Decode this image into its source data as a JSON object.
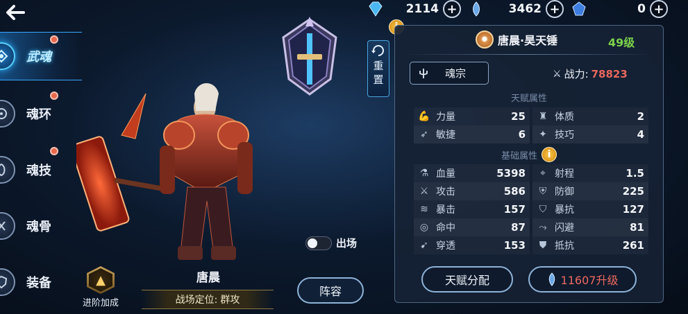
{
  "currencies": [
    {
      "name": "diamond",
      "value": "2114"
    },
    {
      "name": "soul-crystal",
      "value": "3462"
    },
    {
      "name": "blue-gem",
      "value": "0"
    }
  ],
  "nav": {
    "items": [
      {
        "label": "武魂",
        "active": true
      },
      {
        "label": "魂环"
      },
      {
        "label": "魂技"
      },
      {
        "label": "魂骨"
      },
      {
        "label": "装备"
      }
    ]
  },
  "hero": {
    "name": "唐晨",
    "role_label": "战场定位:",
    "role_value": "群攻",
    "advance_label": "进阶加成",
    "toggle_label": "出场",
    "formation_label": "阵容"
  },
  "reset_label": "重置",
  "panel": {
    "weapon_name": "唐晨·昊天锤",
    "level": "49级",
    "sect_label": "魂宗",
    "power_label": "战力:",
    "power_value": "78823",
    "talent_title": "天赋属性",
    "talent_stats": [
      {
        "icon": "arm-icon",
        "name": "力量",
        "value": "25"
      },
      {
        "icon": "body-icon",
        "name": "体质",
        "value": "2"
      },
      {
        "icon": "feather-icon",
        "name": "敏捷",
        "value": "6"
      },
      {
        "icon": "skill-icon",
        "name": "技巧",
        "value": "4"
      }
    ],
    "base_title": "基础属性",
    "base_stats": [
      {
        "icon": "potion-icon",
        "name": "血量",
        "value": "5398"
      },
      {
        "icon": "crosshair-icon",
        "name": "射程",
        "value": "1.5"
      },
      {
        "icon": "sword-icon",
        "name": "攻击",
        "value": "586"
      },
      {
        "icon": "shield-icon",
        "name": "防御",
        "value": "225"
      },
      {
        "icon": "claw-icon",
        "name": "暴击",
        "value": "157"
      },
      {
        "icon": "claw-shield-icon",
        "name": "暴抗",
        "value": "127"
      },
      {
        "icon": "target-icon",
        "name": "命中",
        "value": "87"
      },
      {
        "icon": "dodge-icon",
        "name": "闪避",
        "value": "81"
      },
      {
        "icon": "pierce-icon",
        "name": "穿透",
        "value": "153"
      },
      {
        "icon": "armor-icon",
        "name": "抵抗",
        "value": "261"
      }
    ],
    "talent_btn": "天赋分配",
    "upgrade_cost": "11607升级"
  }
}
